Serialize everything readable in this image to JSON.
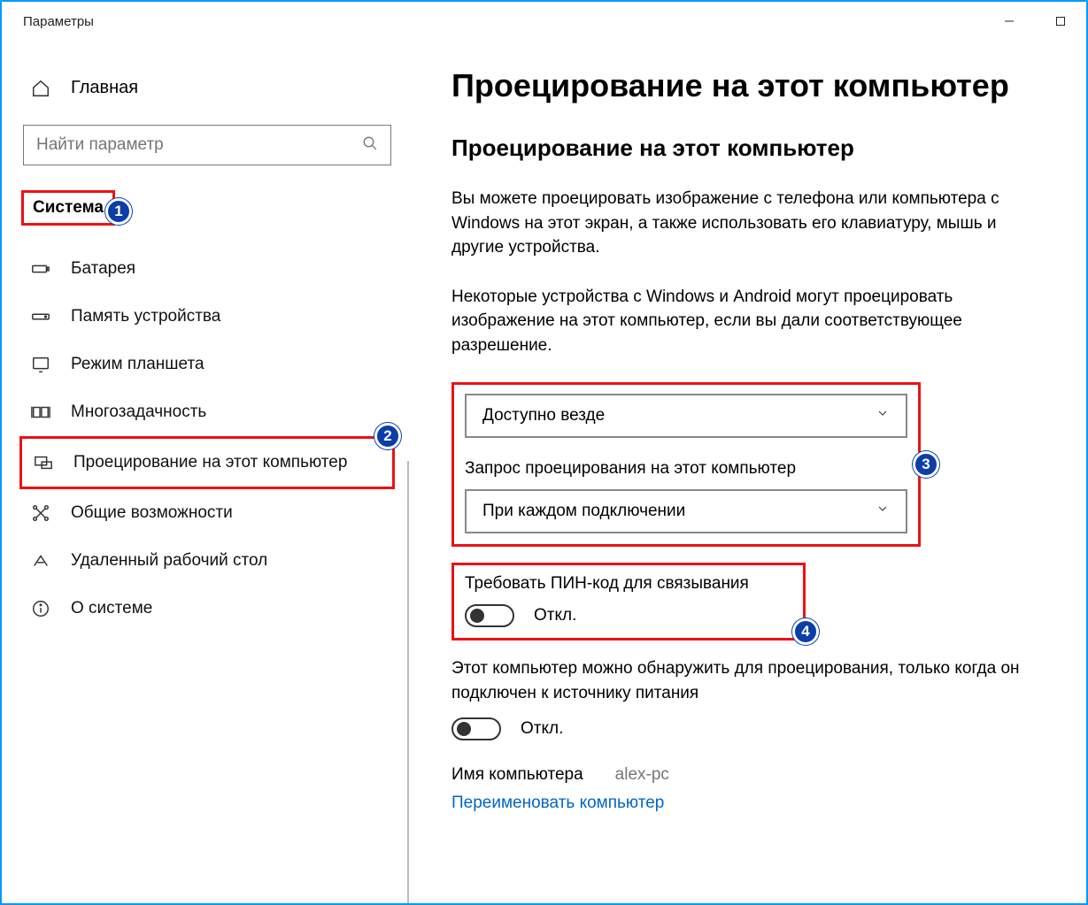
{
  "window": {
    "title": "Параметры"
  },
  "sidebar": {
    "home": "Главная",
    "search_placeholder": "Найти параметр",
    "category": "Система",
    "items": [
      {
        "label": "Батарея"
      },
      {
        "label": "Память устройства"
      },
      {
        "label": "Режим планшета"
      },
      {
        "label": "Многозадачность"
      },
      {
        "label": "Проецирование на этот компьютер"
      },
      {
        "label": "Общие возможности"
      },
      {
        "label": "Удаленный рабочий стол"
      },
      {
        "label": "О системе"
      }
    ]
  },
  "main": {
    "title": "Проецирование на этот компьютер",
    "section_title": "Проецирование на этот компьютер",
    "desc1": "Вы можете проецировать изображение с телефона или компьютера с Windows на этот экран, а также использовать его клавиатуру, мышь и другие устройства.",
    "desc2": "Некоторые устройства с Windows и Android могут проецировать изображение на этот компьютер, если вы дали соответствующее разрешение.",
    "dropdown1": {
      "value": "Доступно везде"
    },
    "setting2_label": "Запрос проецирования на этот компьютер",
    "dropdown2": {
      "value": "При каждом подключении"
    },
    "pin_label": "Требовать ПИН-код для связывания",
    "pin_state": "Откл.",
    "power_label": "Этот компьютер можно обнаружить для проецирования, только когда он подключен к источнику питания",
    "power_state": "Откл.",
    "pcname_label": "Имя компьютера",
    "pcname_value": "alex-pc",
    "rename_link": "Переименовать компьютер"
  },
  "annotations": {
    "b1": "1",
    "b2": "2",
    "b3": "3",
    "b4": "4"
  }
}
